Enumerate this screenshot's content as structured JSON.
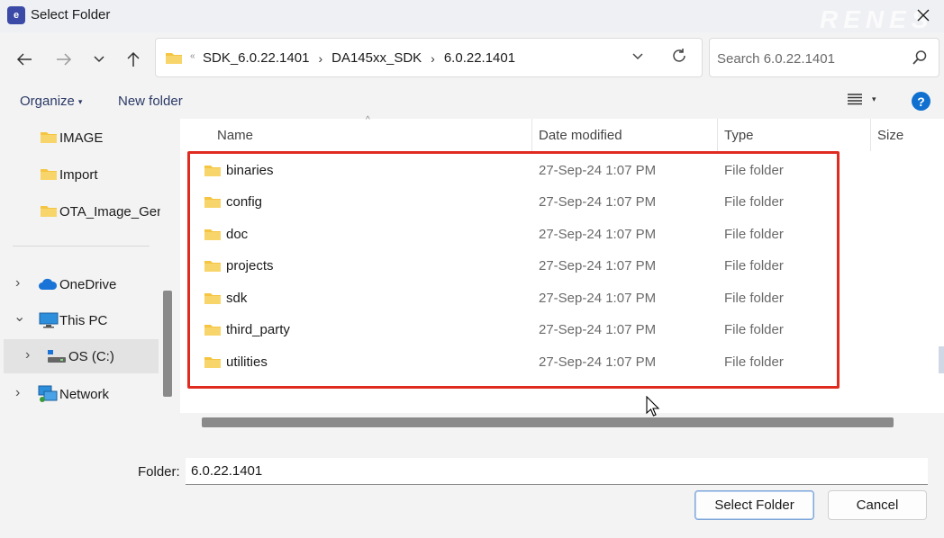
{
  "window": {
    "title": "Select Folder",
    "watermark": "RENES"
  },
  "navigation": {
    "breadcrumbs": [
      "SDK_6.0.22.1401",
      "DA145xx_SDK",
      "6.0.22.1401"
    ],
    "search_placeholder": "Search 6.0.22.1401"
  },
  "commandbar": {
    "organize_label": "Organize",
    "new_folder_label": "New folder"
  },
  "sidebar": {
    "items": [
      {
        "label": "IMAGE",
        "icon": "folder-icon"
      },
      {
        "label": "Import",
        "icon": "folder-icon"
      },
      {
        "label": "OTA_Image_Gen",
        "icon": "folder-icon"
      },
      {
        "label": "OneDrive",
        "icon": "cloud-icon",
        "expand": "›"
      },
      {
        "label": "This PC",
        "icon": "pc-icon",
        "expand": "⌄"
      },
      {
        "label": "OS (C:)",
        "icon": "drive-icon",
        "expand": "›",
        "selected": true
      },
      {
        "label": "Network",
        "icon": "network-icon",
        "expand": "›"
      }
    ]
  },
  "file_list": {
    "columns": [
      "Name",
      "Date modified",
      "Type",
      "Size"
    ],
    "rows": [
      {
        "name": "binaries",
        "date": "27-Sep-24 1:07 PM",
        "type": "File folder"
      },
      {
        "name": "config",
        "date": "27-Sep-24 1:07 PM",
        "type": "File folder"
      },
      {
        "name": "doc",
        "date": "27-Sep-24 1:07 PM",
        "type": "File folder"
      },
      {
        "name": "projects",
        "date": "27-Sep-24 1:07 PM",
        "type": "File folder"
      },
      {
        "name": "sdk",
        "date": "27-Sep-24 1:07 PM",
        "type": "File folder"
      },
      {
        "name": "third_party",
        "date": "27-Sep-24 1:07 PM",
        "type": "File folder"
      },
      {
        "name": "utilities",
        "date": "27-Sep-24 1:07 PM",
        "type": "File folder"
      }
    ]
  },
  "footer": {
    "folder_label": "Folder:",
    "folder_value": "6.0.22.1401",
    "select_button": "Select Folder",
    "cancel_button": "Cancel"
  },
  "colors": {
    "highlight_border": "#e02b20",
    "folder_yellow": "#f5c542",
    "help_blue": "#1170cf"
  }
}
